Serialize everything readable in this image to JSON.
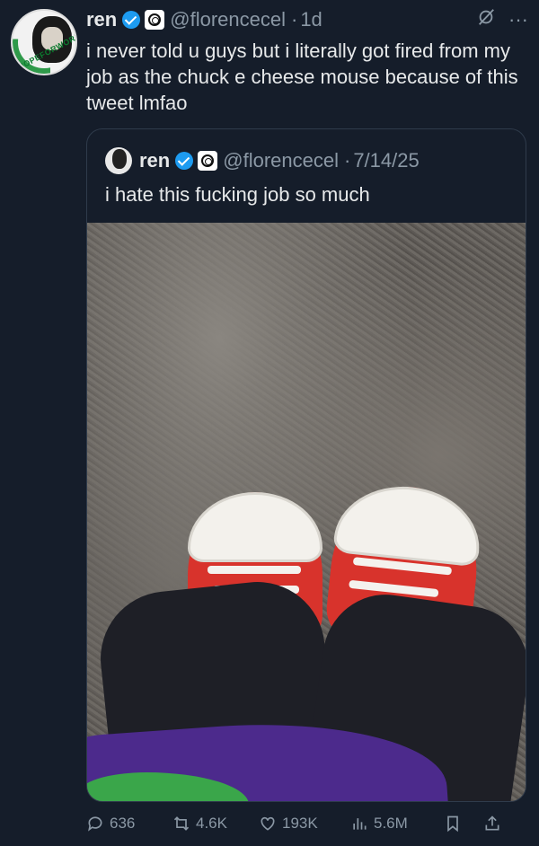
{
  "tweet": {
    "author_name": "ren",
    "author_handle": "@florencecel",
    "separator": "·",
    "time": "1d",
    "avatar_ring_text": "HOPEFORWORK",
    "text": "i never told u guys but i literally got fired from my job as the chuck e cheese mouse because of this tweet lmfao",
    "more_label": "···"
  },
  "quote": {
    "author_name": "ren",
    "author_handle": "@florencecel",
    "separator": "·",
    "date": "7/14/25",
    "text": "i hate this fucking job so much"
  },
  "actions": {
    "replies": "636",
    "retweets": "4.6K",
    "likes": "193K",
    "views": "5.6M"
  },
  "colors": {
    "background": "#151d2a",
    "verified": "#1d9bf0",
    "secondary_text": "#8b98a5"
  }
}
